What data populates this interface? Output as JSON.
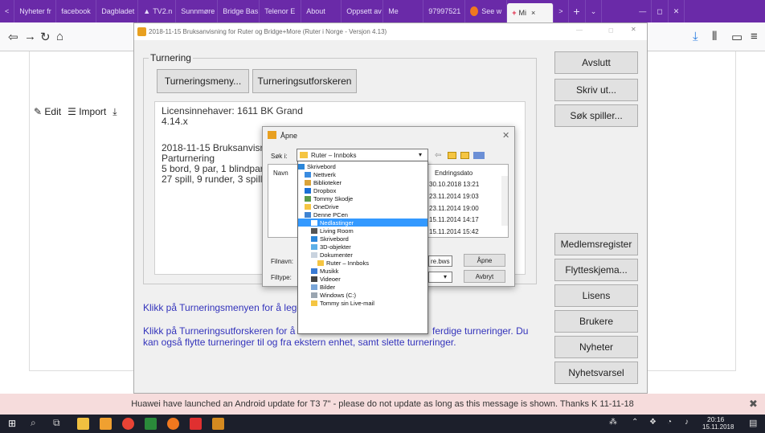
{
  "browser": {
    "tabs": [
      "Nyheter fr",
      "facebook",
      "Dagbladet",
      "TV2.n",
      "Sunnmøre",
      "Bridge Bas",
      "Telenor E",
      "About",
      "Oppsett av",
      "Me",
      "97997521",
      "See w",
      "Mi"
    ],
    "sidebar_buttons": {
      "edit": "Edit",
      "import": "Import"
    }
  },
  "app": {
    "title": "2018-11-15 Bruksanvisning for Ruter og Bridge+More (Ruter i Norge - Versjon 4.13)",
    "group_label": "Turnering",
    "menu_button": "Turneringsmeny...",
    "explorer_button": "Turneringsutforskeren",
    "info": [
      "Licensinnehaver: 1611 BK Grand",
      "4.14.x",
      "",
      "2018-11-15 Bruksanvisn",
      "Parturnering",
      "5 bord, 9 par, 1 blindpar",
      "27 spill, 9 runder, 3 spill p"
    ],
    "hint1": "Klikk på Turneringsmenyen for å legg",
    "hint2a": "Klikk på Turneringsutforskeren for å",
    "hint2b": "ferdige turneringer. Du",
    "hint3": "kan også flytte turneringer til og fra ekstern enhet, samt slette turneringer.",
    "right_buttons": [
      "Avslutt",
      "Skriv ut...",
      "Søk spiller...",
      "Medlemsregister",
      "Flytteskjema...",
      "Lisens",
      "Brukere",
      "Nyheter",
      "Nyhetsvarsel"
    ]
  },
  "dialog": {
    "title": "Åpne",
    "search_label": "Søk i:",
    "search_value": "Ruter – Innboks",
    "col_name": "Navn",
    "col_date": "Endringsdato",
    "dates": [
      "30.10.2018 13:21",
      "23.11.2014 19:03",
      "23.11.2014 19:00",
      "15.11.2014 14:17",
      "15.11.2014 15:42"
    ],
    "filename_label": "Filnavn:",
    "filetype_label": "Filtype:",
    "file_ext": "re.bws",
    "open_button": "Åpne",
    "cancel_button": "Avbryt"
  },
  "dropdown": {
    "items": [
      "Skrivebord",
      "Nettverk",
      "Biblioteker",
      "Dropbox",
      "Tommy Skodje",
      "OneDrive",
      "Denne PCen",
      "Nedlastinger",
      "Living Room",
      "Skrivebord",
      "3D-objekter",
      "Dokumenter",
      "Ruter – Innboks",
      "Musikk",
      "Videoer",
      "Bilder",
      "Windows (C:)",
      "Tommy sin Live-mail"
    ],
    "selected_index": 7
  },
  "notification": "Huawei have launched an Android update for T3 7\" - please do not update as long as this message is shown. Thanks K 11-11-18",
  "taskbar": {
    "time": "20:16",
    "date": "15.11.2018"
  },
  "colors": {
    "tabbar": "#6a2aa8",
    "accent": "#3399ff",
    "hint": "#3333bb"
  }
}
